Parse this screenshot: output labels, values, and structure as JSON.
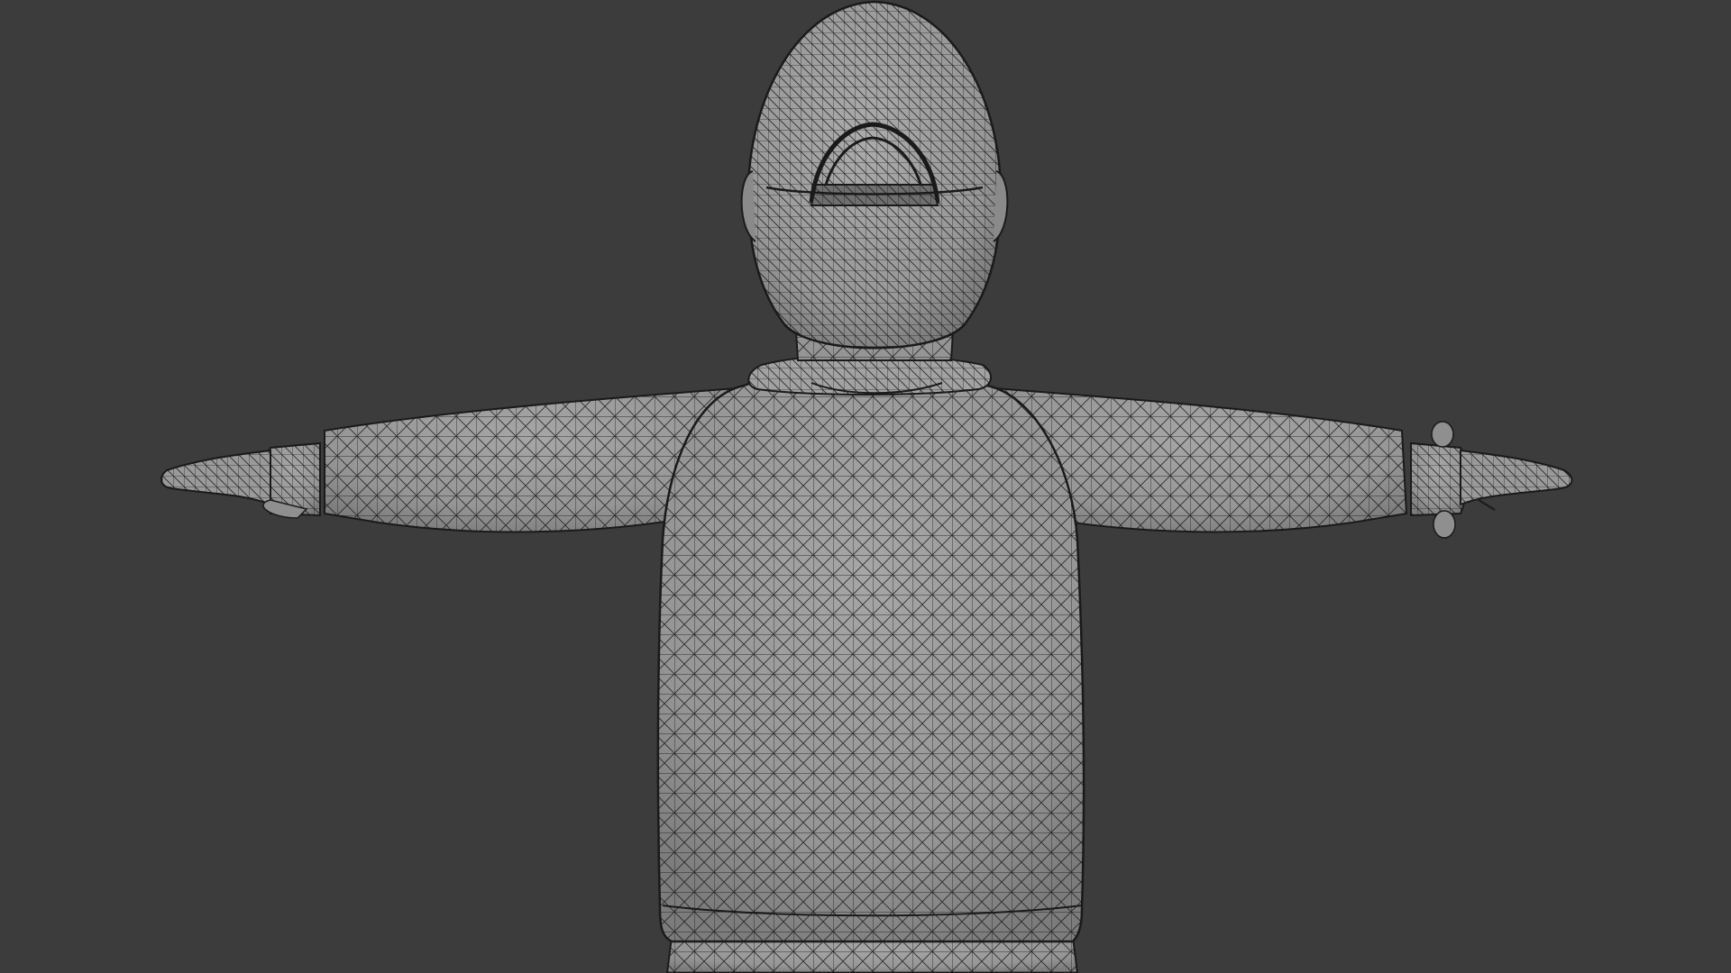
{
  "viewport": {
    "background_color": "#3c3c3c",
    "mesh_fill_color": "#9a9a9a",
    "mesh_shadow_color": "#7e7e7e",
    "wire_color": "#1a1a1a",
    "view_mode": "wireframe-overlay",
    "object": "character-mesh-t-pose-back-view"
  }
}
